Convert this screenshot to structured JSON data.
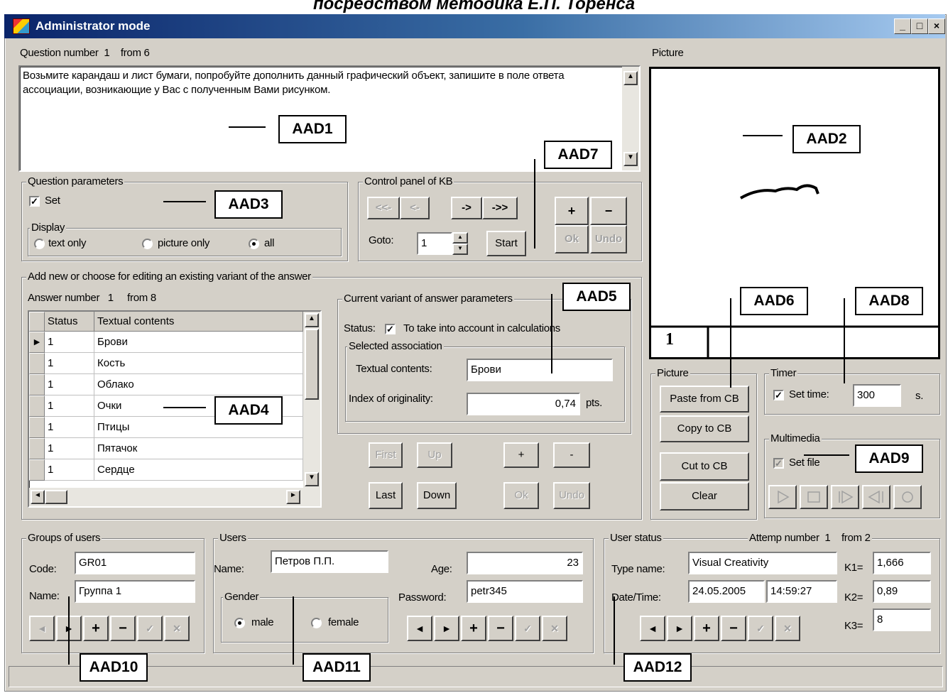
{
  "top_caption": "посредством методика Е.П. Торенса",
  "window": {
    "title": "Administrator mode",
    "min": "_",
    "max": "□",
    "close": "×"
  },
  "question": {
    "number_label": "Question number",
    "number": "1",
    "from_label": "from",
    "total": "6",
    "text": "Возьмите карандаш и лист бумаги, попробуйте дополнить данный графический объект, запишите в поле ответа ассоциации, возникающие у Вас с полученным Вами рисунком."
  },
  "picture": {
    "label": "Picture",
    "frame_number": "1"
  },
  "question_params": {
    "title": "Question parameters",
    "set_label": "Set",
    "set_checked": true,
    "display_title": "Display",
    "options": [
      "text only",
      "picture only",
      "all"
    ],
    "selected": "all"
  },
  "control_panel": {
    "title": "Control panel of KB",
    "nav": [
      "<<-",
      "<-",
      "->",
      "->>"
    ],
    "goto_label": "Goto:",
    "goto_value": "1",
    "start": "Start",
    "plus": "+",
    "minus": "−",
    "ok": "Ok",
    "undo": "Undo"
  },
  "answers": {
    "title": "Add new or choose for editing an existing variant of the answer",
    "number_label": "Answer number",
    "number": "1",
    "from_label": "from",
    "total": "8",
    "columns": [
      "Status",
      "Textual contents"
    ],
    "rows": [
      {
        "status": "1",
        "text": "Брови"
      },
      {
        "status": "1",
        "text": "Кость"
      },
      {
        "status": "1",
        "text": "Облако"
      },
      {
        "status": "1",
        "text": "Очки"
      },
      {
        "status": "1",
        "text": "Птицы"
      },
      {
        "status": "1",
        "text": "Пятачок"
      },
      {
        "status": "1",
        "text": "Сердце"
      }
    ],
    "nav": [
      "First",
      "Up",
      "Last",
      "Down"
    ],
    "plus": "+",
    "minus": "-",
    "ok": "Ok",
    "undo": "Undo"
  },
  "variant_params": {
    "title": "Current variant of answer parameters",
    "status_label": "Status:",
    "status_check_label": "To take into account in calculations",
    "selected_title": "Selected association",
    "textual_label": "Textual contents:",
    "textual_value": "Брови",
    "originality_label": "Index of originality:",
    "originality_value": "0,74",
    "originality_unit": "pts."
  },
  "picture_group": {
    "title": "Picture",
    "buttons": [
      "Paste from CB",
      "Copy to CB",
      "Cut to CB",
      "Clear"
    ]
  },
  "timer": {
    "title": "Timer",
    "set_label": "Set time:",
    "value": "300",
    "unit": "s."
  },
  "multimedia": {
    "title": "Multimedia",
    "set_label": "Set file"
  },
  "groups": {
    "title": "Groups of users",
    "code_label": "Code:",
    "code_value": "GR01",
    "name_label": "Name:",
    "name_value": "Группа 1"
  },
  "users": {
    "title": "Users",
    "name_label": "Name:",
    "name_value": "Петров П.П.",
    "age_label": "Age:",
    "age_value": "23",
    "gender_title": "Gender",
    "genders": [
      "male",
      "female"
    ],
    "gender_selected": "male",
    "password_label": "Password:",
    "password_value": "petr345"
  },
  "user_status": {
    "title": "User status",
    "attempt_label": "Attemp number",
    "attempt": "1",
    "from_label": "from",
    "attempt_total": "2",
    "type_label": "Type name:",
    "type_value": "Visual Creativity",
    "datetime_label": "Date/Time:",
    "date_value": "24.05.2005",
    "time_value": "14:59:27",
    "k1_label": "K1=",
    "k1_value": "1,666",
    "k2_label": "K2=",
    "k2_value": "0,89",
    "k3_label": "K3=",
    "k3_value": "8"
  },
  "record_nav": [
    "◄",
    "►",
    "+",
    "−",
    "✓",
    "✕"
  ],
  "callouts": [
    "AAD1",
    "AAD2",
    "AAD3",
    "AAD4",
    "AAD5",
    "AAD6",
    "AAD7",
    "AAD8",
    "AAD9",
    "AAD10",
    "AAD11",
    "AAD12"
  ]
}
